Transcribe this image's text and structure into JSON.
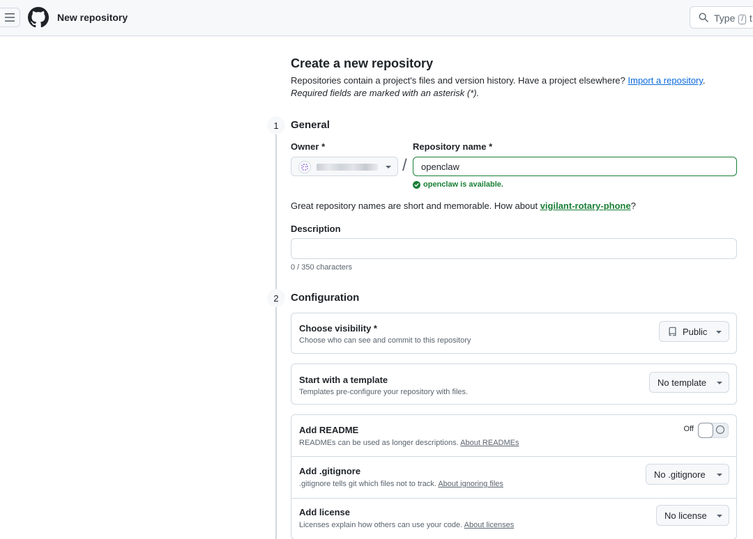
{
  "header": {
    "title": "New repository",
    "search_text": "Type",
    "search_kbd": "/",
    "search_after": "t"
  },
  "intro": {
    "title": "Create a new repository",
    "text": "Repositories contain a project's files and version history. Have a project elsewhere?",
    "import_link": "Import a repository",
    "period": ".",
    "required_note": "Required fields are marked with an asterisk (*)."
  },
  "general": {
    "step": "1",
    "title": "General",
    "owner_label": "Owner *",
    "repo_label": "Repository name *",
    "slash": "/",
    "repo_value": "openclaw",
    "available": "openclaw is available.",
    "suggest_text": "Great repository names are short and memorable. How about",
    "suggest_name": "vigilant-rotary-phone",
    "suggest_end": "?",
    "description_label": "Description",
    "description_value": "",
    "char_count": "0 / 350 characters"
  },
  "configuration": {
    "step": "2",
    "title": "Configuration",
    "visibility": {
      "title": "Choose visibility *",
      "sub": "Choose who can see and commit to this repository",
      "value": "Public"
    },
    "template": {
      "title": "Start with a template",
      "sub": "Templates pre-configure your repository with files.",
      "value": "No template"
    },
    "readme": {
      "title": "Add README",
      "sub": "READMEs can be used as longer descriptions.",
      "link": "About READMEs",
      "toggle_label": "Off"
    },
    "gitignore": {
      "title": "Add .gitignore",
      "sub": ".gitignore tells git which files not to track.",
      "link": "About ignoring files",
      "value": "No .gitignore"
    },
    "license": {
      "title": "Add license",
      "sub": "Licenses explain how others can use your code.",
      "link": "About licenses",
      "value": "No license"
    }
  },
  "colors": {
    "accent_link": "#0969da",
    "success": "#1a7f37",
    "border": "#d1d9e0",
    "muted": "#59636e"
  }
}
